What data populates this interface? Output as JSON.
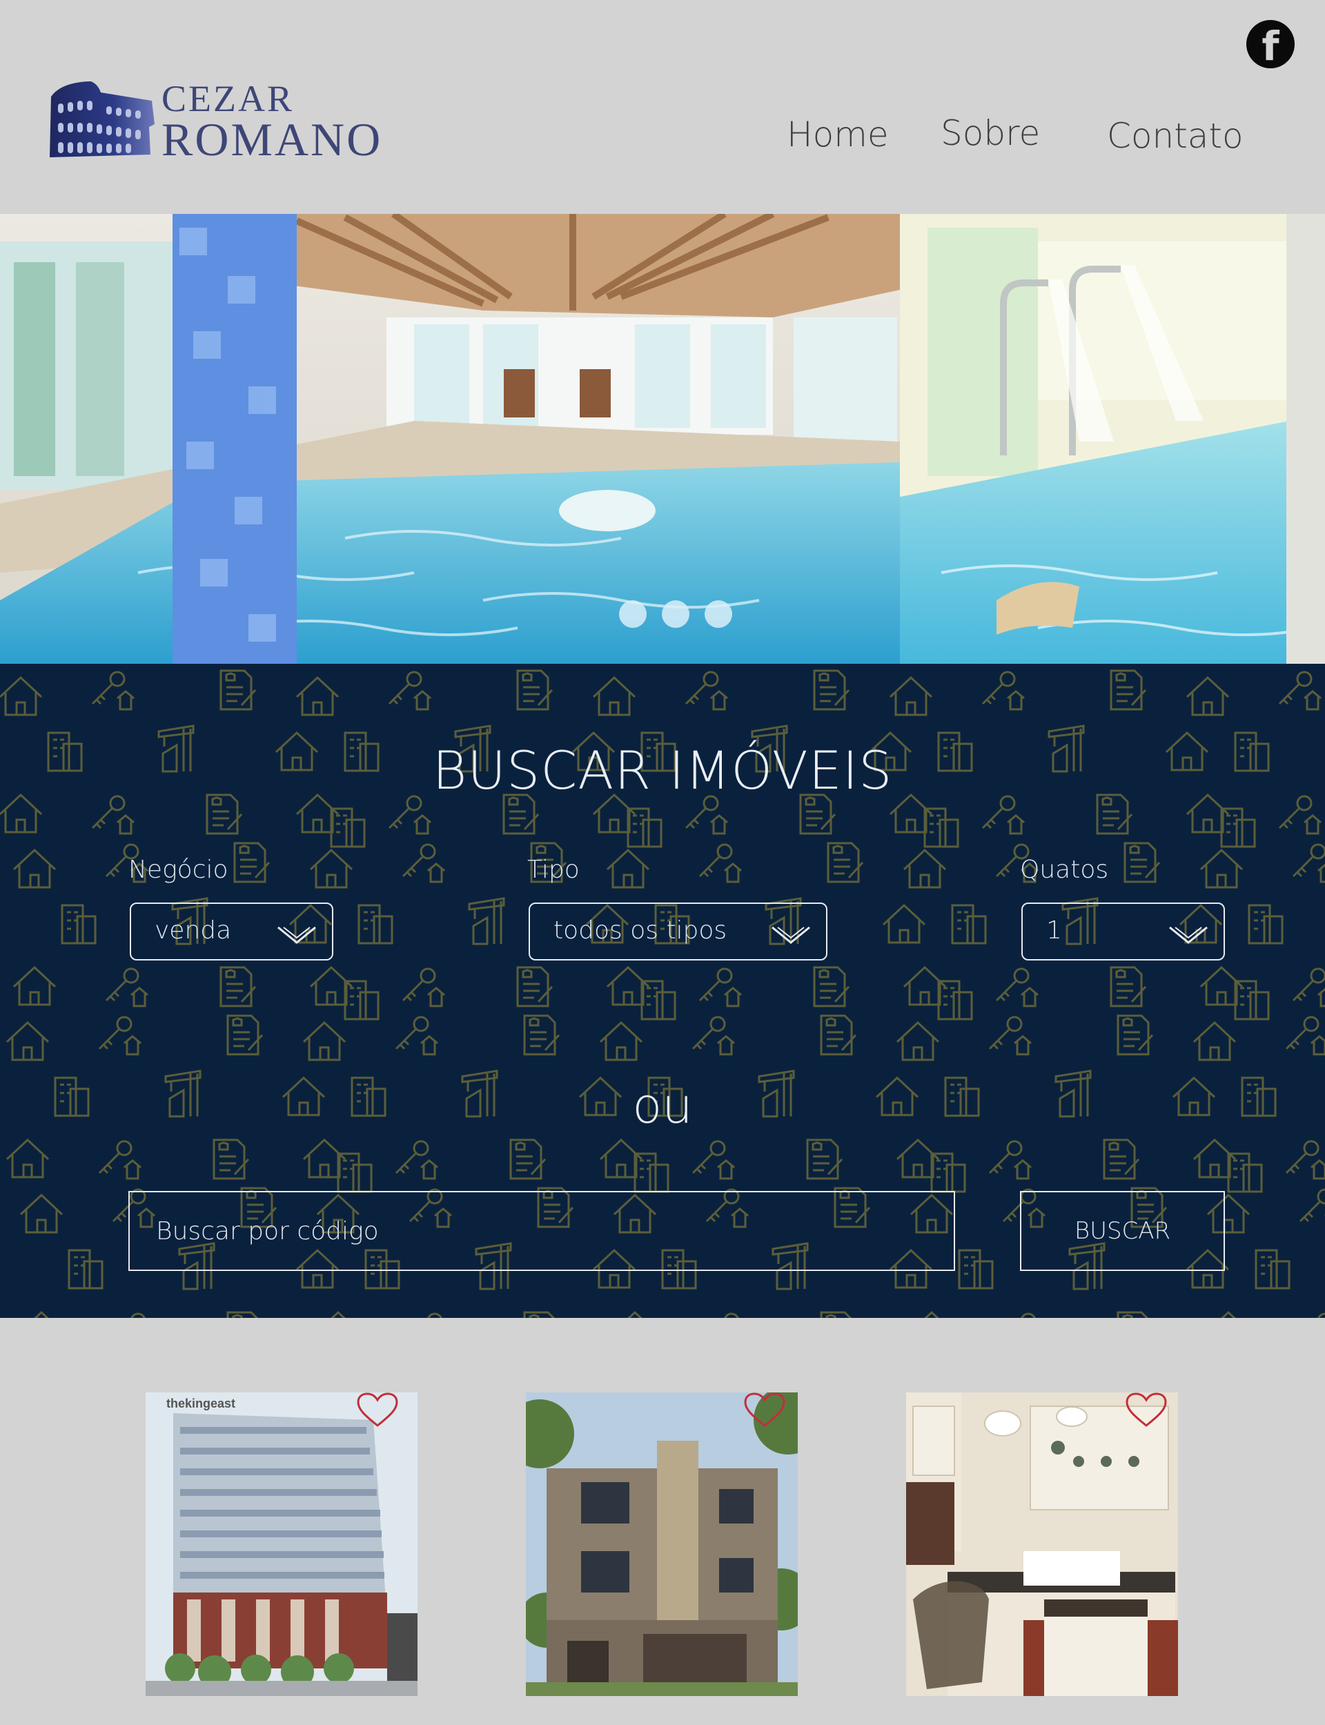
{
  "social": {
    "icon": "facebook-icon",
    "glyph": "f"
  },
  "brand": {
    "line1": "CEZAR",
    "line2": "ROMANO",
    "logo_icon": "colosseum-icon",
    "color": "#3e4677"
  },
  "nav": {
    "items": [
      {
        "label": "Home"
      },
      {
        "label": "Sobre"
      },
      {
        "label": "Contato"
      }
    ]
  },
  "hero": {
    "slides_count": 3
  },
  "search": {
    "title": "BUSCAR IMÓVEIS",
    "negocio": {
      "label": "Negócio",
      "value": "venda"
    },
    "tipo": {
      "label": "Tipo",
      "value": "todos os tipos"
    },
    "quartos": {
      "label": "Quatos",
      "value": "1"
    },
    "or_text": "ou",
    "code_placeholder": "Buscar por código",
    "button_label": "BUSCAR",
    "background_color": "#0a213d",
    "pattern_color": "#6b6a3a"
  },
  "listings": [
    {
      "watermark": "thekingeast",
      "favorite_icon": "heart-icon"
    },
    {
      "favorite_icon": "heart-icon"
    },
    {
      "favorite_icon": "heart-icon"
    }
  ]
}
